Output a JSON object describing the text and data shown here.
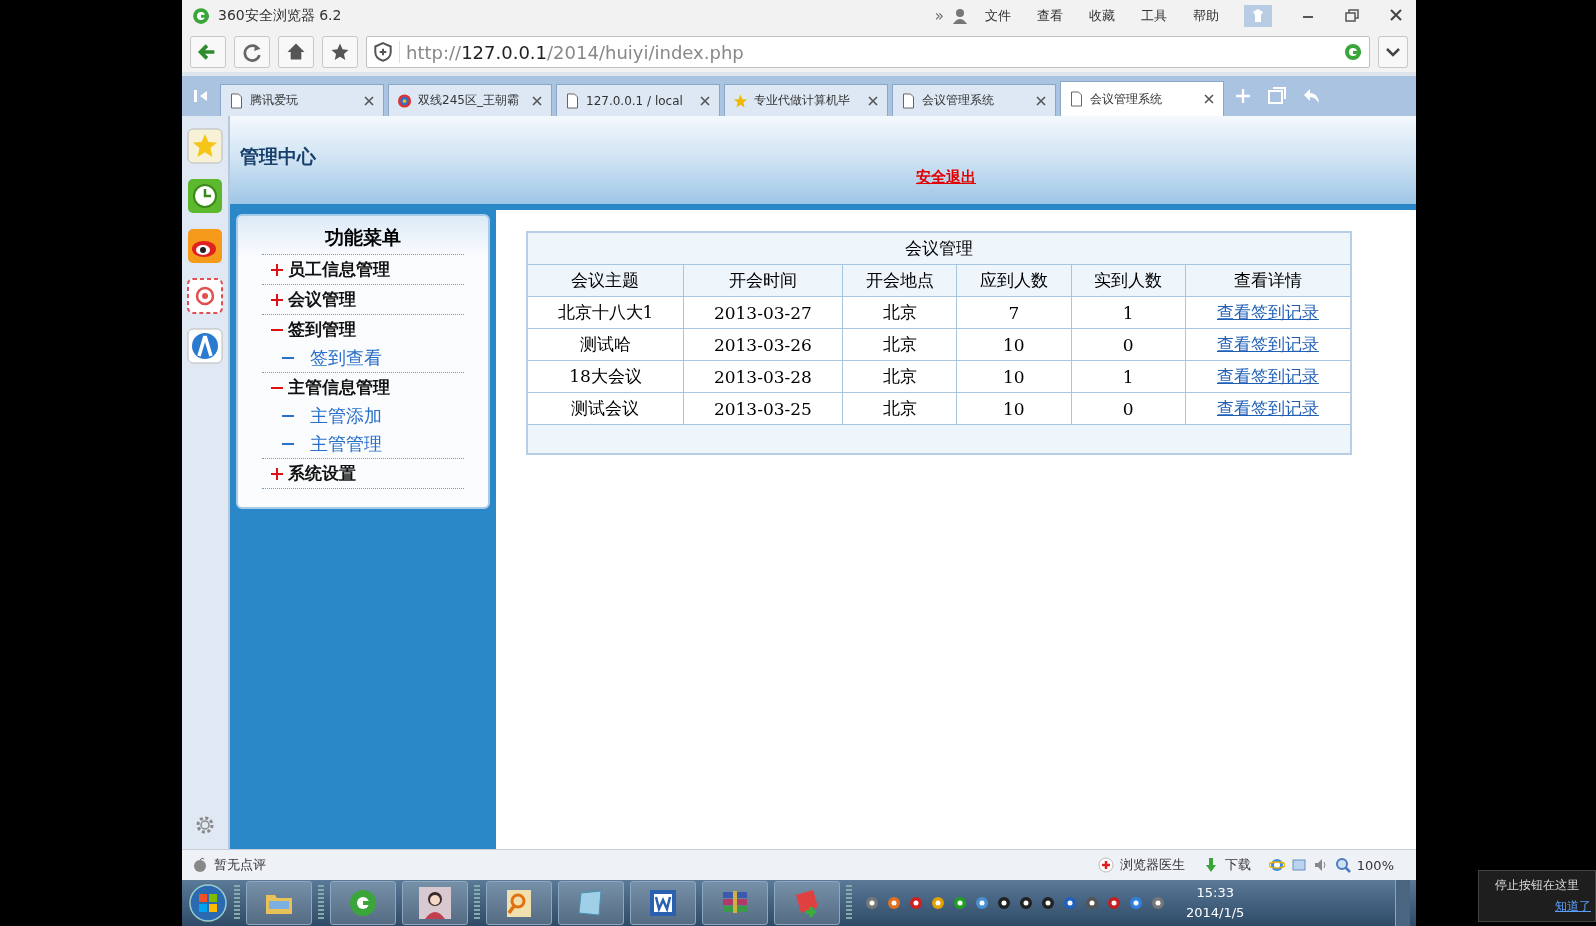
{
  "browser": {
    "title": "360安全浏览器 6.2",
    "more": "»",
    "menus": [
      "文件",
      "查看",
      "收藏",
      "工具",
      "帮助"
    ],
    "url": {
      "scheme": "http://",
      "host": "127.0.0.1",
      "path": "/2014/huiyi/index.php"
    }
  },
  "tabs": [
    {
      "label": "腾讯爱玩",
      "kind": "page",
      "selected": false
    },
    {
      "label": "双线245区_王朝霸",
      "kind": "site",
      "selected": false
    },
    {
      "label": "127.0.0.1 / local",
      "kind": "page",
      "selected": false
    },
    {
      "label": "专业代做计算机毕",
      "kind": "favorite",
      "selected": false
    },
    {
      "label": "会议管理系统",
      "kind": "page",
      "selected": false
    },
    {
      "label": "会议管理系统",
      "kind": "page",
      "selected": true
    }
  ],
  "header": {
    "title": "管理中心",
    "logout": "安全退出"
  },
  "menu": {
    "title": "功能菜单",
    "items": [
      {
        "label": "员工信息管理",
        "expanded": false
      },
      {
        "label": "会议管理",
        "expanded": false
      },
      {
        "label": "签到管理",
        "expanded": true,
        "children": [
          {
            "label": "签到查看"
          }
        ]
      },
      {
        "label": "主管信息管理",
        "expanded": true,
        "children": [
          {
            "label": "主管添加"
          },
          {
            "label": "主管管理"
          }
        ]
      },
      {
        "label": "系统设置",
        "expanded": false
      }
    ]
  },
  "table": {
    "caption": "会议管理",
    "columns": [
      "会议主题",
      "开会时间",
      "开会地点",
      "应到人数",
      "实到人数",
      "查看详情"
    ],
    "rows": [
      [
        "北京十八大1",
        "2013-03-27",
        "北京",
        "7",
        "1",
        "查看签到记录"
      ],
      [
        "测试哈",
        "2013-03-26",
        "北京",
        "10",
        "0",
        "查看签到记录"
      ],
      [
        "18大会议",
        "2013-03-28",
        "北京",
        "10",
        "1",
        "查看签到记录"
      ],
      [
        "测试会议",
        "2013-03-25",
        "北京",
        "10",
        "0",
        "查看签到记录"
      ]
    ]
  },
  "status_bar": {
    "rating": "暂无点评",
    "doctor": "浏览器医生",
    "download": "下载",
    "zoom": "100%"
  },
  "taskbar": {
    "time": "15:33",
    "date": "2014/1/5"
  },
  "tooltip": {
    "text": "停止按钮在这里",
    "link": "知道了"
  }
}
